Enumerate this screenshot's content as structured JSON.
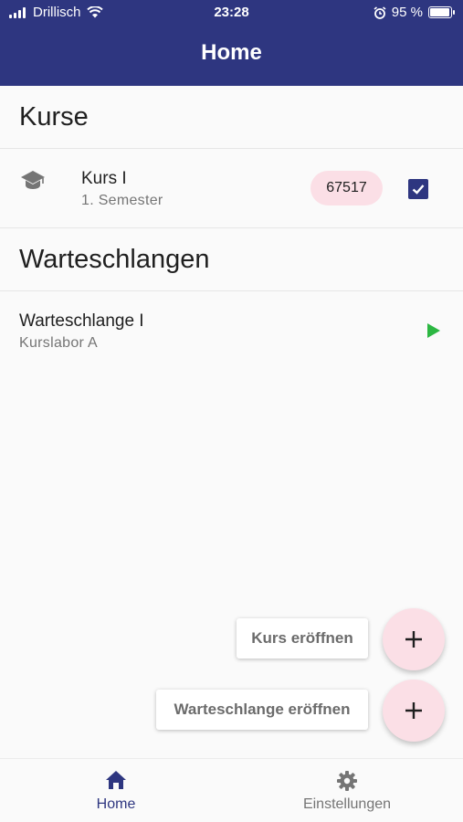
{
  "status_bar": {
    "carrier": "Drillisch",
    "time": "23:28",
    "battery": "95 %"
  },
  "app_bar": {
    "title": "Home"
  },
  "courses_section": {
    "title": "Kurse",
    "items": [
      {
        "title": "Kurs I",
        "subtitle": "1. Semester",
        "code": "67517",
        "checked": true,
        "icon": "school-cap-icon"
      }
    ]
  },
  "queues_section": {
    "title": "Warteschlangen",
    "items": [
      {
        "title": "Warteschlange I",
        "subtitle": "Kurslabor A",
        "icon": "play-icon"
      }
    ]
  },
  "actions": {
    "open_course": "Kurs eröffnen",
    "open_queue": "Warteschlange eröffnen"
  },
  "bottom_nav": {
    "items": [
      {
        "label": "Home",
        "icon": "home-icon",
        "active": true
      },
      {
        "label": "Einstellungen",
        "icon": "gear-icon",
        "active": false
      }
    ]
  },
  "colors": {
    "primary": "#2e3680",
    "accent_pink": "#fbdfe6",
    "play_green": "#2cb742",
    "inactive": "#757575"
  }
}
